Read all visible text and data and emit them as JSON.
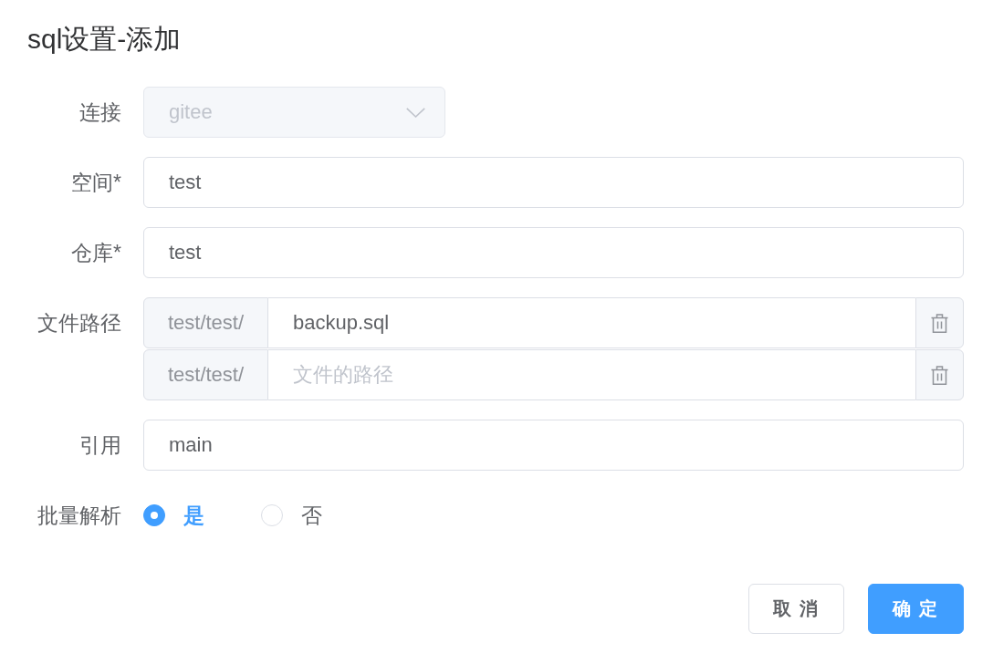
{
  "title": "sql设置-添加",
  "form": {
    "fields": [
      {
        "kind": "select",
        "label": "连接",
        "value": "gitee",
        "disabled": true
      },
      {
        "kind": "input",
        "label": "空间*",
        "value": "test"
      },
      {
        "kind": "input",
        "label": "仓库*",
        "value": "test"
      },
      {
        "kind": "paths",
        "label": "文件路径",
        "rows": [
          {
            "prefix": "test/test/",
            "value": "backup.sql"
          },
          {
            "prefix": "test/test/",
            "placeholder": "文件的路径"
          }
        ]
      },
      {
        "kind": "input",
        "label": "引用",
        "value": "main"
      },
      {
        "kind": "radio",
        "label": "批量解析",
        "options": [
          {
            "label": "是",
            "selected": true
          },
          {
            "label": "否",
            "selected": false
          }
        ]
      }
    ]
  },
  "buttons": [
    {
      "label": "取 消",
      "kind": "default"
    },
    {
      "label": "确 定",
      "kind": "primary"
    }
  ]
}
